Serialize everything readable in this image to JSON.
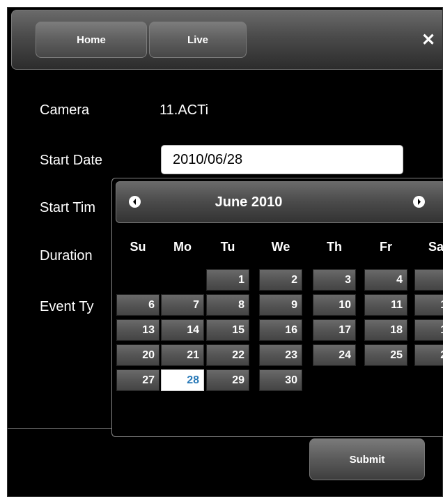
{
  "nav": {
    "home_label": "Home",
    "live_label": "Live"
  },
  "form": {
    "camera_label": "Camera",
    "camera_value": "11.ACTi",
    "start_date_label": "Start Date",
    "start_date_value": "2010/06/28",
    "start_time_label": "Start Tim",
    "duration_label": "Duration",
    "event_type_label": "Event Ty"
  },
  "calendar": {
    "title": "June 2010",
    "weekdays": [
      "Su",
      "Mo",
      "Tu",
      "We",
      "Th",
      "Fr",
      "Sa"
    ],
    "first_weekday_index": 2,
    "days_in_month": 30,
    "selected_day": 28
  },
  "submit_label": "Submit",
  "colors": {
    "today_text": "#2a7ab8"
  }
}
